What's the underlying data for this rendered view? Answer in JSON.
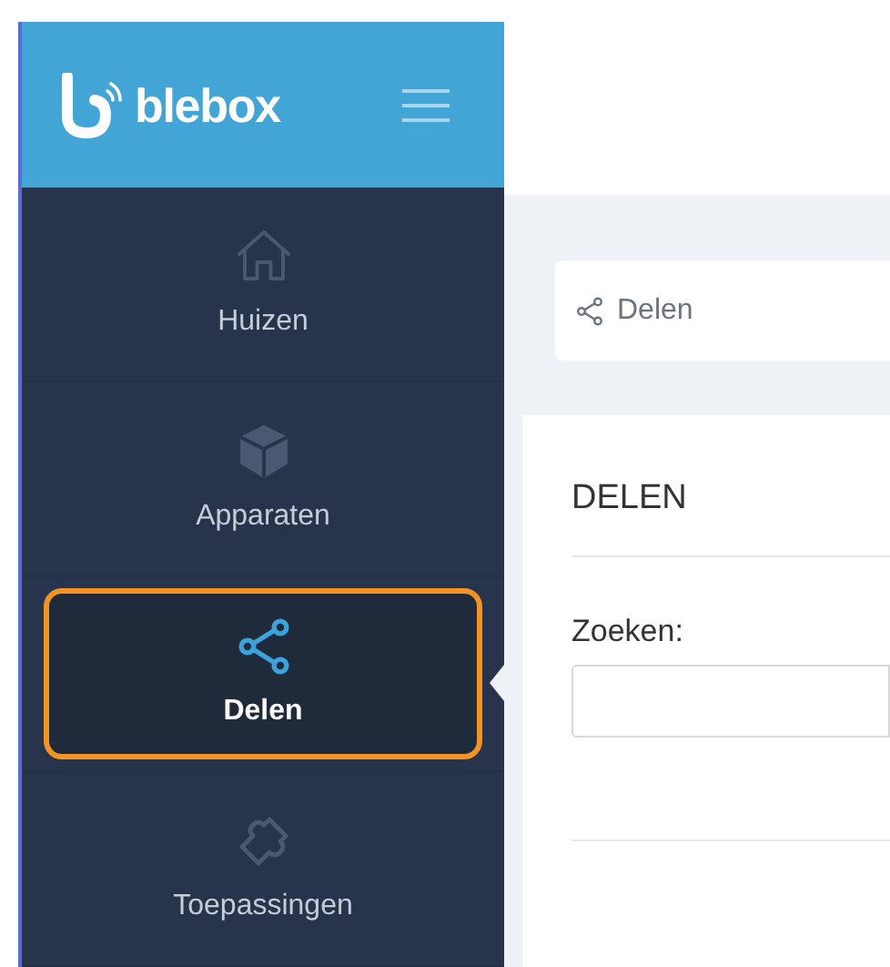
{
  "logo": {
    "text": "blebox"
  },
  "sidebar": {
    "items": [
      {
        "label": "Huizen",
        "kind": "home",
        "selected": false
      },
      {
        "label": "Apparaten",
        "kind": "cube",
        "selected": false
      },
      {
        "label": "Delen",
        "kind": "share",
        "selected": true
      },
      {
        "label": "Toepassingen",
        "kind": "puzzle",
        "selected": false
      }
    ]
  },
  "breadcrumb": {
    "label": "Delen"
  },
  "panel": {
    "title": "DELEN",
    "search_label": "Zoeken:"
  }
}
